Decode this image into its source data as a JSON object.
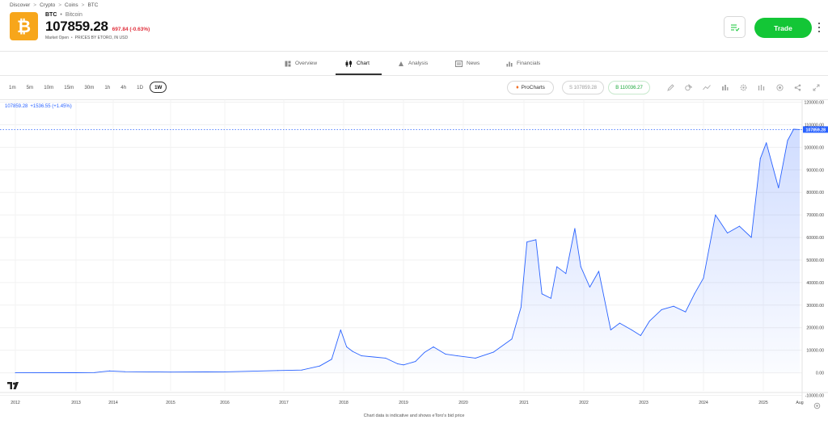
{
  "breadcrumb": [
    "Discover",
    "Crypto",
    "Coins",
    "BTC"
  ],
  "asset": {
    "symbol": "BTC",
    "name": "Bitcoin",
    "price": "107859.28",
    "change": "697.84 (-0.63%)",
    "market_status": "Market Open",
    "price_note": "PRICES BY ETORO, IN USD",
    "logo_glyph": "₿",
    "logo_color": "#f7a61b"
  },
  "actions": {
    "trade_label": "Trade",
    "trade_color": "#13c636"
  },
  "tabs": [
    {
      "label": "Overview",
      "icon": "overview-icon",
      "active": false
    },
    {
      "label": "Chart",
      "icon": "chart-icon",
      "active": true
    },
    {
      "label": "Analysis",
      "icon": "analysis-icon",
      "active": false
    },
    {
      "label": "News",
      "icon": "news-icon",
      "active": false
    },
    {
      "label": "Financials",
      "icon": "financials-icon",
      "active": false
    }
  ],
  "timeframes": [
    "1m",
    "5m",
    "10m",
    "15m",
    "30m",
    "1h",
    "4h",
    "1D",
    "1W"
  ],
  "active_timeframe": "1W",
  "toolbar": {
    "prochart_label": "ProCharts",
    "sell_label": "S 107859.28",
    "buy_label": "B 110036.27",
    "tools": [
      "pencil-icon",
      "shapes-icon",
      "trend-line-icon",
      "indicators-icon",
      "settings-icon",
      "bar-type-icon",
      "alert-icon",
      "share-icon",
      "fullscreen-icon"
    ]
  },
  "chart_legend": {
    "price": "107859.28",
    "change": "+1536.55 (+1.45%)"
  },
  "footer_note": "Chart data is indicative and shows eToro's bid price",
  "chart_data": {
    "type": "area",
    "x_ticks": [
      "2012",
      "2013",
      "2014",
      "2015",
      "2016",
      "2017",
      "2018",
      "2019",
      "2020",
      "2021",
      "2022",
      "2023",
      "2024",
      "2025",
      "Aug"
    ],
    "y_ticks": [
      "-10000.00",
      "0.00",
      "10000.00",
      "20000.00",
      "30000.00",
      "40000.00",
      "50000.00",
      "60000.00",
      "70000.00",
      "80000.00",
      "90000.00",
      "100000.00",
      "110000.00",
      "120000.00"
    ],
    "ylim": [
      -10000,
      120000
    ],
    "current_price_label": "107859.28",
    "line_color": "#2962ff",
    "grid": true,
    "series": [
      {
        "x": [
          2012.0,
          2013.0,
          2013.5,
          2013.9,
          2014.2,
          2015.0,
          2016.0,
          2016.9,
          2017.3,
          2017.6,
          2017.8,
          2017.95,
          2018.05,
          2018.15,
          2018.3,
          2018.5,
          2018.7,
          2018.9,
          2019.0,
          2019.2,
          2019.35,
          2019.5,
          2019.7,
          2019.9,
          2020.2,
          2020.5,
          2020.8,
          2020.95,
          2021.05,
          2021.2,
          2021.3,
          2021.45,
          2021.55,
          2021.7,
          2021.85,
          2021.95,
          2022.1,
          2022.25,
          2022.45,
          2022.6,
          2022.8,
          2022.95,
          2023.1,
          2023.3,
          2023.5,
          2023.7,
          2023.85,
          2024.0,
          2024.2,
          2024.4,
          2024.6,
          2024.8,
          2024.95,
          2025.05,
          2025.25,
          2025.4,
          2025.5,
          2025.6
        ],
        "values": [
          0,
          13,
          100,
          800,
          500,
          300,
          430,
          1000,
          1200,
          3000,
          6000,
          19000,
          11500,
          9500,
          7500,
          7000,
          6500,
          4000,
          3500,
          5000,
          9000,
          11500,
          8300,
          7500,
          6500,
          9200,
          15000,
          29000,
          58000,
          59000,
          35000,
          33000,
          47000,
          44000,
          64000,
          47000,
          38000,
          45000,
          19000,
          22000,
          19000,
          16500,
          23000,
          28000,
          29500,
          27000,
          35000,
          42000,
          70000,
          62000,
          65000,
          60000,
          95000,
          102000,
          82000,
          103000,
          108000,
          107859
        ]
      }
    ]
  }
}
